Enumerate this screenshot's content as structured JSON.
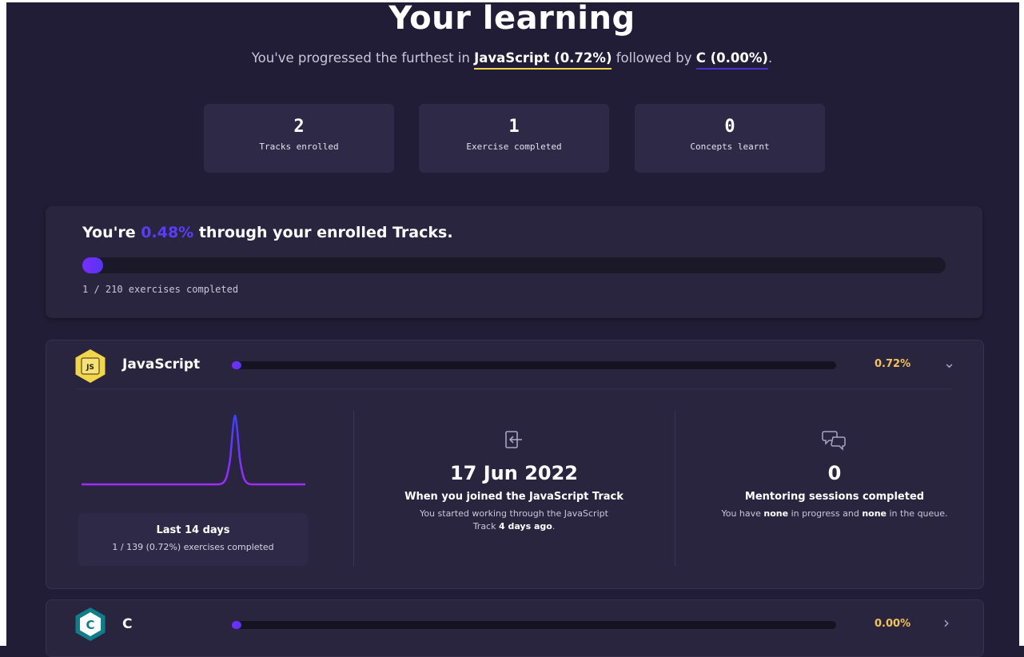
{
  "header": {
    "title": "Your learning",
    "subtitle_prefix": "You've progressed the furthest in ",
    "top_track": "JavaScript (0.72%)",
    "subtitle_mid": " followed by ",
    "second_track": "C (0.00%)",
    "subtitle_suffix": "."
  },
  "stats": [
    {
      "value": "2",
      "label": "Tracks enrolled"
    },
    {
      "value": "1",
      "label": "Exercise completed"
    },
    {
      "value": "0",
      "label": "Concepts learnt"
    }
  ],
  "overall": {
    "prefix": "You're ",
    "percent": "0.48%",
    "suffix": " through your enrolled Tracks.",
    "progress_fraction": 0.0048,
    "count_text": "1 / 210 exercises completed"
  },
  "tracks": [
    {
      "name": "JavaScript",
      "icon": "javascript-hexagon-icon",
      "icon_text": "JS",
      "percent": "0.72%",
      "progress_fraction": 0.0072,
      "expanded": true,
      "activity": {
        "title": "Last 14 days",
        "summary": "1 / 139 (0.72%) exercises completed"
      },
      "joined": {
        "icon": "sign-in-icon",
        "date": "17 Jun 2022",
        "caption": "When you joined the JavaScript Track",
        "desc_prefix": "You started working through the JavaScript Track ",
        "desc_bold": "4 days ago",
        "desc_suffix": "."
      },
      "mentoring": {
        "icon": "chat-bubbles-icon",
        "count": "0",
        "caption": "Mentoring sessions completed",
        "desc_1": "You have ",
        "desc_bold_1": "none",
        "desc_2": " in progress and ",
        "desc_bold_2": "none",
        "desc_3": " in the queue."
      }
    },
    {
      "name": "C",
      "icon": "c-hexagon-icon",
      "icon_text": "C",
      "percent": "0.00%",
      "progress_fraction": 0.0,
      "expanded": false
    }
  ],
  "colors": {
    "background": "#211d36",
    "card": "#29253f",
    "accent_purple": "#5b3df6",
    "js_yellow": "#f1d54b",
    "percent_orange": "#f2c25c",
    "c_teal": "#0f7d8a"
  }
}
